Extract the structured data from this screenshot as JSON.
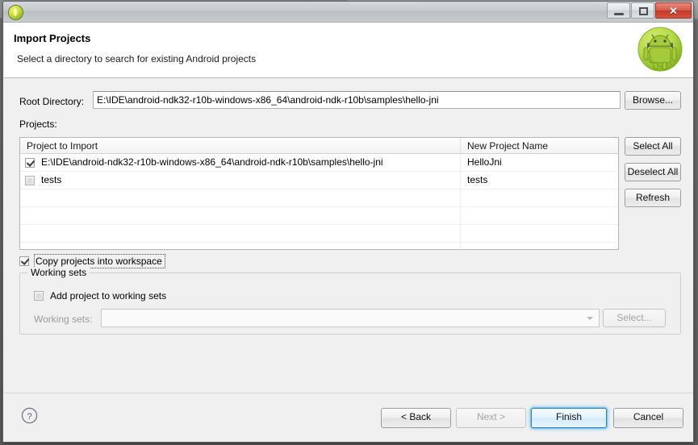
{
  "window": {
    "icon": "eclipse-circle-icon",
    "title": "",
    "controls": {
      "minimize": "minimize-icon",
      "maximize": "maximize-icon",
      "close": "✕"
    }
  },
  "banner": {
    "title": "Import Projects",
    "subtitle": "Select a directory to search for existing Android projects",
    "logo": "android-robot-icon"
  },
  "form": {
    "root_directory_label": "Root Directory:",
    "root_directory_value": "E:\\IDE\\android-ndk32-r10b-windows-x86_64\\android-ndk-r10b\\samples\\hello-jni",
    "browse_label": "Browse...",
    "projects_label": "Projects:"
  },
  "table": {
    "columns": [
      "Project to Import",
      "New Project Name"
    ],
    "rows": [
      {
        "checked": true,
        "project": "E:\\IDE\\android-ndk32-r10b-windows-x86_64\\android-ndk-r10b\\samples\\hello-jni",
        "name": "HelloJni"
      },
      {
        "checked": false,
        "project": "tests",
        "name": "tests"
      }
    ],
    "side_buttons": [
      {
        "label": "Select All",
        "disabled": false
      },
      {
        "label": "Deselect All",
        "disabled": false
      },
      {
        "label": "Refresh",
        "disabled": false
      }
    ]
  },
  "options": {
    "copy_projects_label": "Copy projects into workspace",
    "copy_projects_checked": true
  },
  "working_sets": {
    "group_title": "Working sets",
    "add_project_label": "Add project to working sets",
    "add_project_checked": false,
    "combo_label": "Working sets:",
    "combo_value": "",
    "combo_disabled": true,
    "select_label": "Select...",
    "select_disabled": true
  },
  "footer": {
    "help": "?",
    "buttons": [
      {
        "label": "< Back",
        "disabled": false,
        "default": false
      },
      {
        "label": "Next >",
        "disabled": true,
        "default": false
      },
      {
        "label": "Finish",
        "disabled": false,
        "default": true
      },
      {
        "label": "Cancel",
        "disabled": false,
        "default": false
      }
    ]
  },
  "colors": {
    "dialog_bg": "#f0f0f0",
    "banner_bg": "#ffffff",
    "accent": "#2f7fb8",
    "close_red": "#c03a29",
    "android_green": "#a4c639"
  }
}
